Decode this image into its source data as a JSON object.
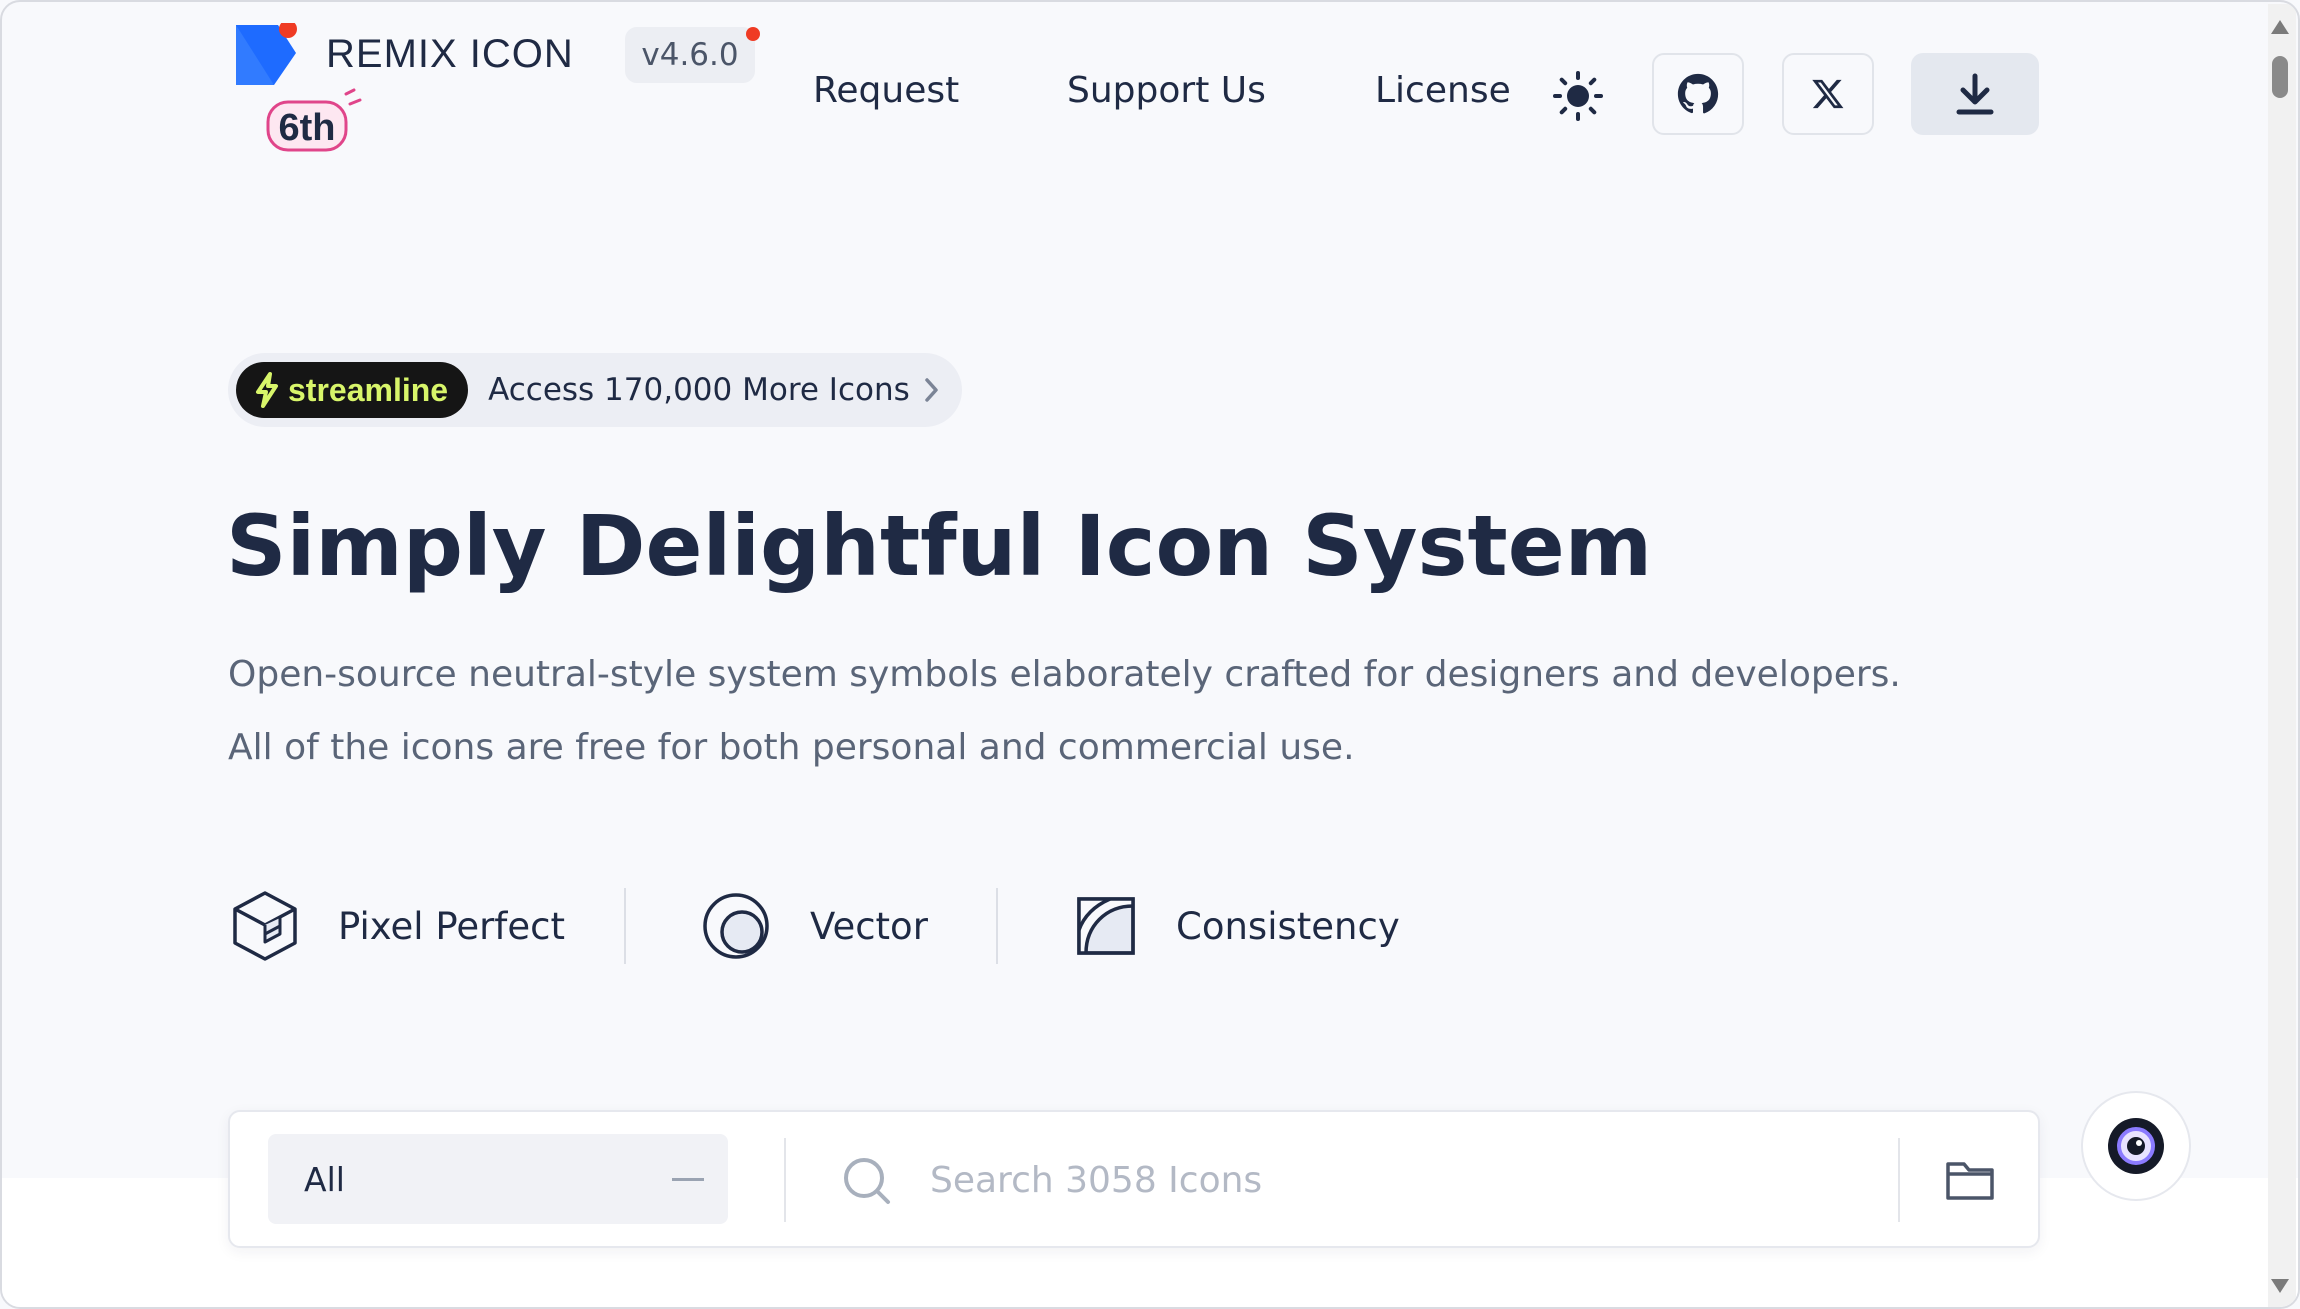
{
  "brand": {
    "name": "REMIX ICON",
    "version": "v4.6.0",
    "anniversary_badge": "6th",
    "logo_color": "#1e6bff",
    "accent_dot_color": "#ef3b24"
  },
  "nav": {
    "items": [
      {
        "label": "Request"
      },
      {
        "label": "Support Us"
      },
      {
        "label": "License"
      }
    ],
    "icons": [
      "sun-icon",
      "github-icon",
      "x-icon",
      "download-icon"
    ]
  },
  "promo": {
    "brand": "streamline",
    "text": "Access 170,000 More Icons",
    "brand_color": "#d8f56a"
  },
  "hero": {
    "title": "Simply Delightful Icon System",
    "line1": "Open-source neutral-style system symbols elaborately crafted for designers and developers.",
    "line2": "All of the icons are free for both personal and commercial use."
  },
  "features": [
    {
      "label": "Pixel Perfect",
      "icon": "cube-icon"
    },
    {
      "label": "Vector",
      "icon": "circle-icon"
    },
    {
      "label": "Consistency",
      "icon": "curve-icon"
    }
  ],
  "search": {
    "category": "All",
    "placeholder": "Search 3058 Icons",
    "value": ""
  }
}
